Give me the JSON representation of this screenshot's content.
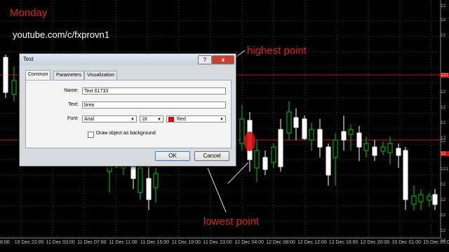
{
  "overlay": {
    "day_label": "Monday",
    "channel": "youtube.com/c/fxprovn1",
    "high_label": "highest point",
    "low_label": "lowest point"
  },
  "colors": {
    "background": "#000000",
    "up": "#ffffff",
    "down": "#00cc00",
    "level_line": "#d01010",
    "annotation": "#e02020"
  },
  "price_axis": [
    "12",
    "12",
    "12",
    "121",
    "12",
    "12",
    "12",
    "12",
    "12",
    "12",
    "121",
    "12",
    "12",
    "12",
    "12",
    "12"
  ],
  "time_axis": [
    "8:00",
    "10 Dec 22:00",
    "11 Dec 03:00",
    "11 Dec 07:00",
    "11 Dec 11:00",
    "11 Dec 15:00",
    "11 Dec 19:00",
    "11 Dec 23:00",
    "12 Dec 04:00",
    "12 Dec 08:00",
    "12 Dec 12:00",
    "12 Dec 16:00",
    "12 Dec 20:00",
    "15 Dec 01:00",
    "15 Dec 05:00"
  ],
  "dialog": {
    "title": "Text",
    "help": "?",
    "close": "x",
    "tabs": [
      "Common",
      "Parameters",
      "Visualization"
    ],
    "name_label": "Name:",
    "name_value": "Text 61733",
    "text_label": "Text:",
    "text_value": "brea",
    "font_label": "Font:",
    "font_value": "Arial",
    "size_value": "18",
    "color_value": "Red",
    "background_checkbox": "Draw object as background",
    "ok": "OK",
    "cancel": "Cancel"
  }
}
